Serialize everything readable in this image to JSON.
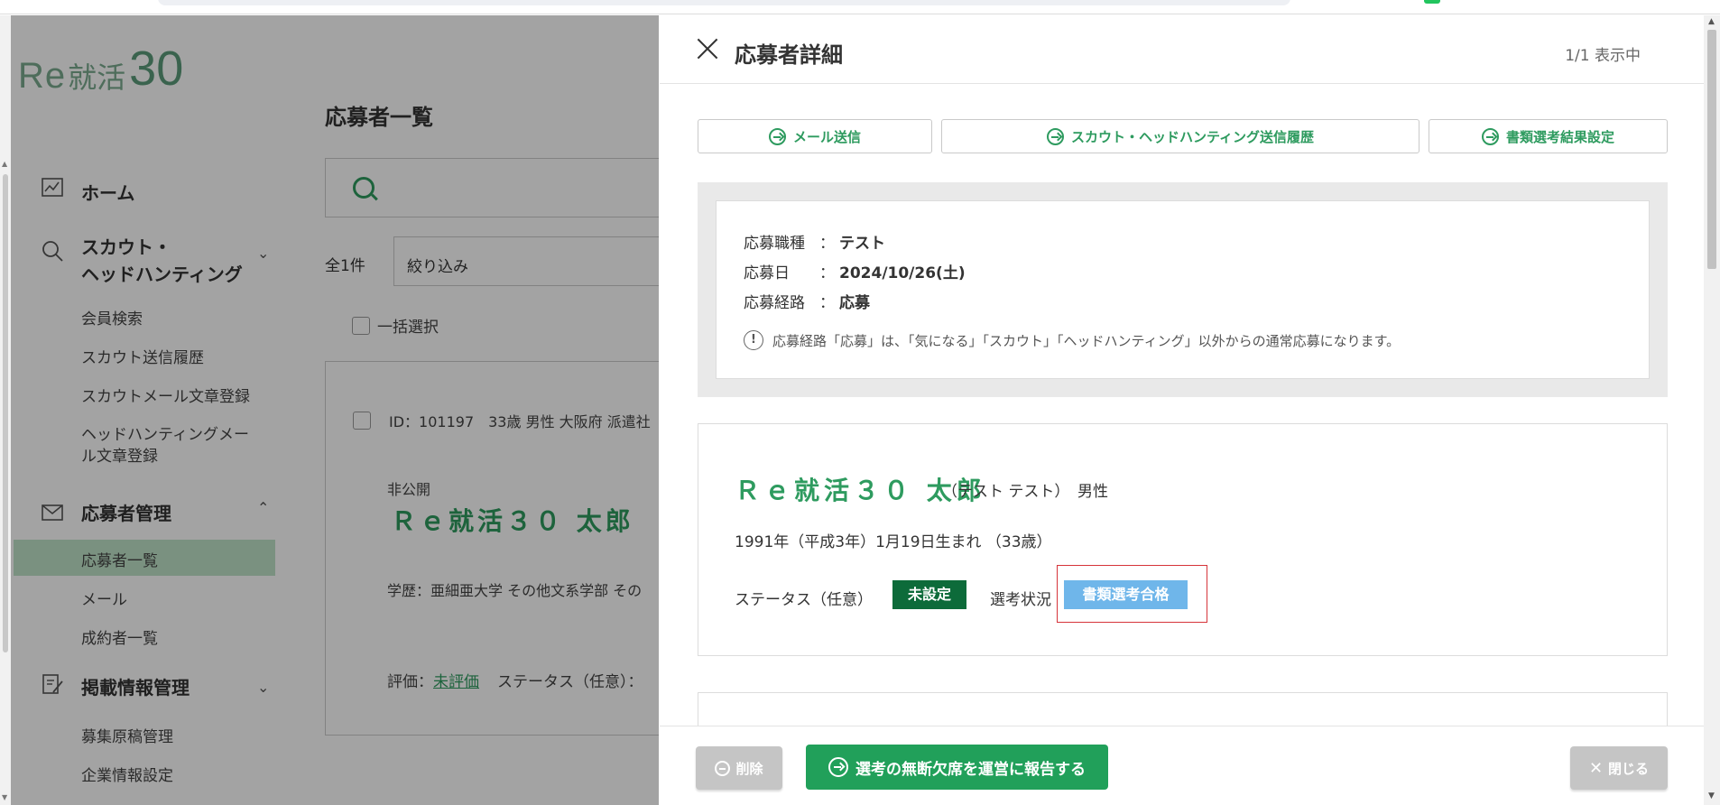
{
  "brand": {
    "re": "Re",
    "ja": "就活",
    "num": "30"
  },
  "sidebar": {
    "items": [
      {
        "label": "ホーム",
        "icon": "home-chart-icon"
      },
      {
        "label": "スカウト・\nヘッドハンティング",
        "icon": "search-icon"
      },
      {
        "label": "会員検索"
      },
      {
        "label": "スカウト送信履歴"
      },
      {
        "label": "スカウトメール文章登録"
      },
      {
        "label": "ヘッドハンティングメー\nル文章登録"
      },
      {
        "label": "応募者管理",
        "icon": "mail-icon"
      },
      {
        "label": "応募者一覧"
      },
      {
        "label": "メール"
      },
      {
        "label": "成約者一覧"
      },
      {
        "label": "掲載情報管理",
        "icon": "edit-document-icon"
      },
      {
        "label": "募集原稿管理"
      },
      {
        "label": "企業情報設定"
      }
    ]
  },
  "list": {
    "title": "応募者一覧",
    "total": "全1件",
    "filter": "絞り込み",
    "bulk_select": "一括選択",
    "card": {
      "id_line": "ID：101197　33歳 男性 大阪府 派遣社",
      "visibility": "非公開",
      "name": "Ｒｅ就活３０ 太郎",
      "education": "学歴：亜細亜大学 その他文系学部 その",
      "eval_label": "評価：",
      "eval_value": "未評価",
      "status_label": "ステータス（任意）："
    }
  },
  "panel": {
    "title": "応募者詳細",
    "count": "1/1 表示中",
    "buttons": {
      "mail": "メール送信",
      "scout_history": "スカウト・ヘッドハンティング送信履歴",
      "screening": "書類選考結果設定"
    },
    "info": {
      "job_label": "応募職種",
      "job_value": "テスト",
      "date_label": "応募日",
      "date_value": "2024/10/26(土)",
      "route_label": "応募経路",
      "route_value": "応募",
      "colon": "：",
      "note": "応募経路「応募」は、「気になる」「スカウト」「ヘッドハンティング」以外からの通常応募になります。"
    },
    "profile": {
      "name": "Ｒｅ就活３０ 太郎",
      "kana": "（テスト テスト）",
      "gender": "男性",
      "birth": "1991年（平成3年）1月19日生まれ （33歳）",
      "status_label": "ステータス（任意）",
      "status_value": "未設定",
      "selection_label": "選考状況",
      "selection_value": "書類選考合格"
    },
    "footer": {
      "delete": "削除",
      "report": "選考の無断欠席を運営に報告する",
      "close": "閉じる"
    }
  },
  "colors": {
    "accent": "#2e9b5f",
    "dark_badge": "#0d6b3a",
    "blue_badge": "#6fb6ea",
    "highlight": "#d6343a"
  }
}
